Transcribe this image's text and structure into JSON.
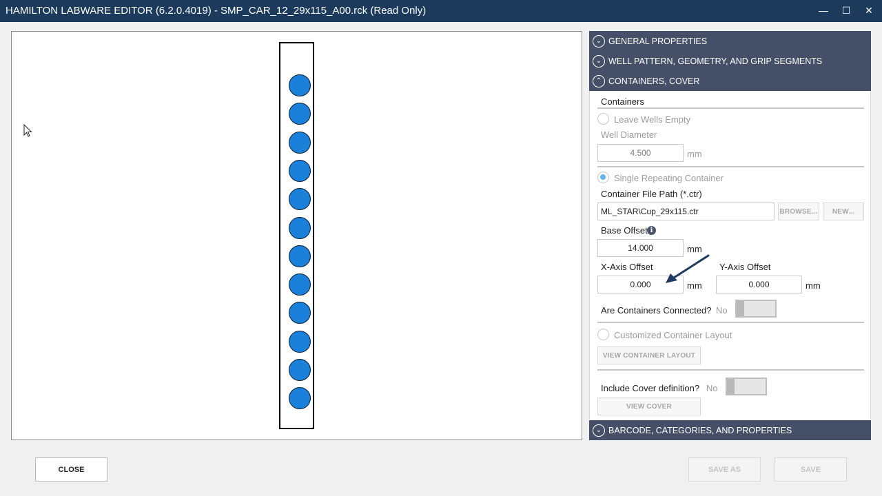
{
  "window": {
    "title": "HAMILTON LABWARE EDITOR (6.2.0.4019) - SMP_CAR_12_29x115_A00.rck (Read Only)",
    "minimize_glyph": "—",
    "maximize_glyph": "☐",
    "close_glyph": "✕"
  },
  "canvas": {
    "well_count": 12,
    "well_color": "#1a80d9"
  },
  "sections": {
    "general": "GENERAL PROPERTIES",
    "well_pattern": "WELL PATTERN, GEOMETRY, AND GRIP SEGMENTS",
    "containers_cover": "CONTAINERS, COVER",
    "barcode": "BARCODE, CATEGORIES, AND PROPERTIES"
  },
  "containers": {
    "heading": "Containers",
    "leave_wells_empty": "Leave Wells Empty",
    "well_diameter_label": "Well Diameter",
    "well_diameter_value": "4.500",
    "mm": "mm",
    "single_repeating": "Single Repeating Container",
    "container_path_label": "Container File Path (*.ctr)",
    "container_path_value": "ML_STAR\\Cup_29x115.ctr",
    "browse_button": "BROWSE...",
    "new_button": "NEW...",
    "base_offset_label": "Base Offset",
    "base_offset_value": "14.000",
    "x_offset_label": "X-Axis Offset",
    "x_offset_value": "0.000",
    "y_offset_label": "Y-Axis Offset",
    "y_offset_value": "0.000",
    "connected_label": "Are Containers Connected?",
    "connected_value": "No",
    "customized_layout": "Customized Container Layout",
    "view_layout_button": "VIEW CONTAINER LAYOUT",
    "cover_label": "Include Cover definition?",
    "cover_value": "No",
    "view_cover_button": "VIEW COVER"
  },
  "footer": {
    "close": "CLOSE",
    "save_as": "SAVE AS",
    "save": "SAVE"
  },
  "icons": {
    "info": "i",
    "chevron_down": "⌄",
    "chevron_up": "⌃"
  },
  "colors": {
    "titlebar": "#1b3a5c",
    "section_header": "#455068",
    "annotation_arrow": "#1f3a5f"
  }
}
